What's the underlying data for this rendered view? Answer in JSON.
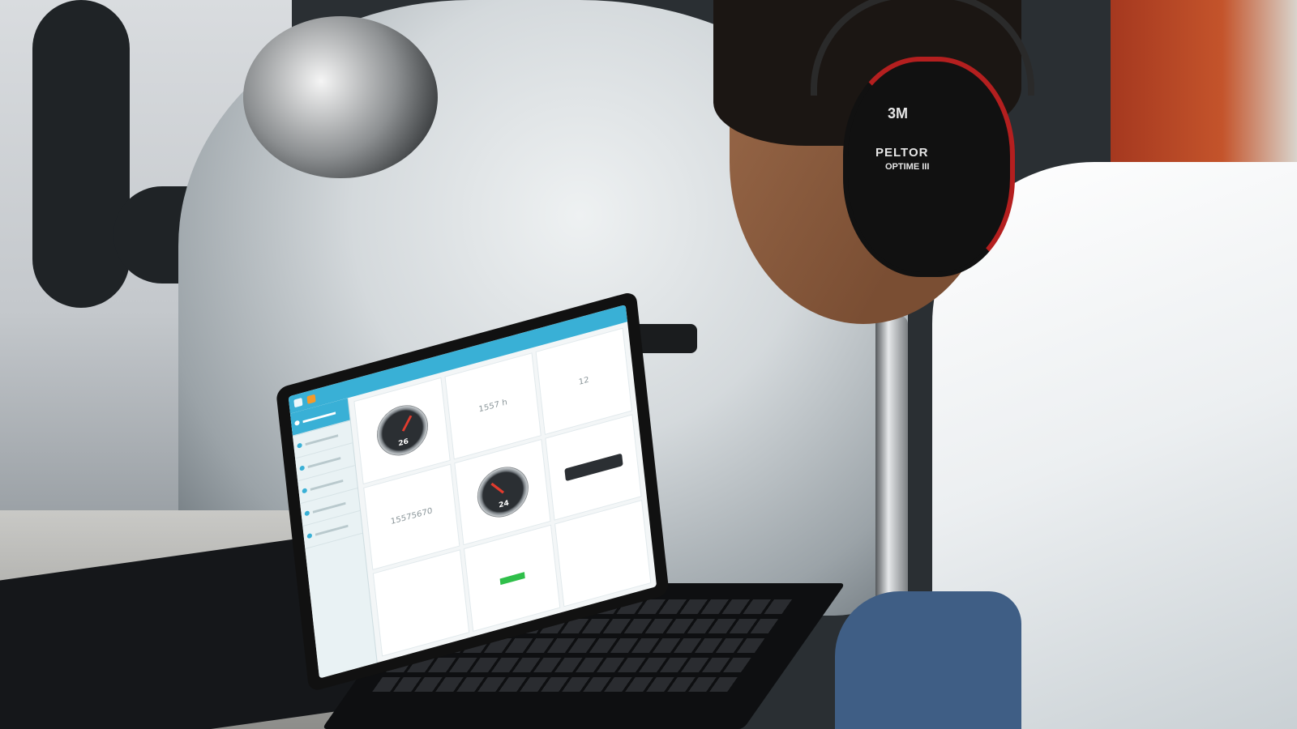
{
  "scene": {
    "description_labels": {
      "earmuff_brand": "3M",
      "earmuff_model": "PELTOR",
      "earmuff_sub": "OPTIME III"
    }
  },
  "laptop_app": {
    "sidebar_items": 6,
    "tiles": [
      {
        "kind": "gauge",
        "value": "26"
      },
      {
        "kind": "text",
        "value": "1557 h"
      },
      {
        "kind": "text",
        "value": "12"
      },
      {
        "kind": "text",
        "value": "15575670"
      },
      {
        "kind": "gauge",
        "value": "24"
      },
      {
        "kind": "bar",
        "value": ""
      }
    ]
  },
  "colors": {
    "app_accent": "#39b0d6",
    "app_orange": "#f39a2b",
    "sensor_led": "#4aa3ff",
    "earmuff_red": "#b41f1f"
  }
}
